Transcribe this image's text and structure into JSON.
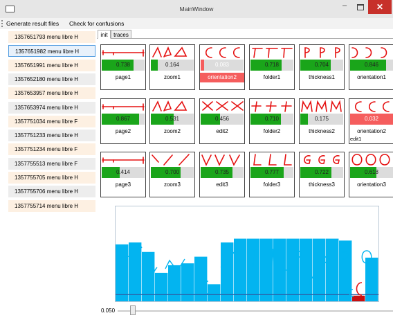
{
  "window": {
    "title": "MainWindow",
    "min_glyph": "–",
    "close_glyph": "✕",
    "close_color": "#c7302a"
  },
  "menu": {
    "items": [
      "Generate result files",
      "Check for confusions"
    ]
  },
  "sessions": [
    {
      "label": "1357651793  menu libre  H",
      "selected": false
    },
    {
      "label": "1357651982  menu libre  H",
      "selected": true
    },
    {
      "label": "1357651991  menu libre  H",
      "selected": false
    },
    {
      "label": "1357652180  menu libre  H",
      "selected": false
    },
    {
      "label": "1357653957  menu libre  H",
      "selected": false
    },
    {
      "label": "1357653974  menu libre  H",
      "selected": false
    },
    {
      "label": "1357751034  menu libre  F",
      "selected": false
    },
    {
      "label": "1357751233  menu libre  H",
      "selected": false
    },
    {
      "label": "1357751234  menu libre  F",
      "selected": false
    },
    {
      "label": "1357755513  menu libre  F",
      "selected": false
    },
    {
      "label": "1357755705  menu libre  H",
      "selected": false
    },
    {
      "label": "1357755706  menu libre  H",
      "selected": false
    },
    {
      "label": "1357755714  menu libre  H",
      "selected": false
    }
  ],
  "tabs": [
    {
      "label": "init",
      "active": true
    },
    {
      "label": "traces",
      "active": false
    }
  ],
  "colors": {
    "score_good": "#1aa51a",
    "score_bad": "#f55d5d",
    "ink": "#e51010",
    "row_orange": "#fdf0e2",
    "row_gray": "#ededed",
    "row_selected": "#e8f1fb",
    "trace_bar": "#03b4f0",
    "trace_line": "#2c63a8"
  },
  "gestures": [
    {
      "name": "page1",
      "score": "0.738",
      "fraction": 0.738,
      "ok": true,
      "glyph": "page"
    },
    {
      "name": "zoom1",
      "score": "0.164",
      "fraction": 0.164,
      "ok": true,
      "glyph": "zoom"
    },
    {
      "name": "orientation2",
      "score": "0.083",
      "fraction": 0.083,
      "ok": false,
      "glyph": "c"
    },
    {
      "name": "folder1",
      "score": "0.718",
      "fraction": 0.718,
      "ok": true,
      "glyph": "folder"
    },
    {
      "name": "thickness1",
      "score": "0.704",
      "fraction": 0.704,
      "ok": true,
      "glyph": "p"
    },
    {
      "name": "orientation1",
      "score": "0.846",
      "fraction": 0.846,
      "ok": true,
      "glyph": "rc"
    },
    {
      "name": "page2",
      "score": "0.867",
      "fraction": 0.867,
      "ok": true,
      "glyph": "page"
    },
    {
      "name": "zoom2",
      "score": "0.531",
      "fraction": 0.531,
      "ok": true,
      "glyph": "zoom"
    },
    {
      "name": "edit2",
      "score": "0.456",
      "fraction": 0.456,
      "ok": true,
      "glyph": "x"
    },
    {
      "name": "folder2",
      "score": "0.710",
      "fraction": 0.71,
      "ok": true,
      "glyph": "cross"
    },
    {
      "name": "thickness2",
      "score": "0.175",
      "fraction": 0.175,
      "ok": true,
      "glyph": "m"
    },
    {
      "name": "orientation2",
      "score": "0.032",
      "fraction": 1.0,
      "ok": false,
      "glyph": "c",
      "tag": "edit1"
    },
    {
      "name": "page3",
      "score": "0.414",
      "fraction": 0.414,
      "ok": true,
      "glyph": "page"
    },
    {
      "name": "zoom3",
      "score": "0.700",
      "fraction": 0.7,
      "ok": true,
      "glyph": "slash"
    },
    {
      "name": "edit3",
      "score": "0.735",
      "fraction": 0.735,
      "ok": true,
      "glyph": "v"
    },
    {
      "name": "folder3",
      "score": "0.777",
      "fraction": 0.777,
      "ok": true,
      "glyph": "l"
    },
    {
      "name": "thickness3",
      "score": "0.722",
      "fraction": 0.722,
      "ok": true,
      "glyph": "g"
    },
    {
      "name": "orientation3",
      "score": "0.618",
      "fraction": 0.618,
      "ok": true,
      "glyph": "o"
    }
  ],
  "trace": {
    "values": [
      0.6,
      0.62,
      0.52,
      0.3,
      0.38,
      0.4,
      0.47,
      0.18,
      0.62,
      0.66,
      0.66,
      0.66,
      0.66,
      0.66,
      0.66,
      0.66,
      0.66,
      0.64,
      0.06,
      0.46
    ],
    "highlighted": 18,
    "highlight_color": "#c81010",
    "baseline_fraction": 0.07
  },
  "slider": {
    "label": "0.050",
    "value_fraction": 0.05
  }
}
